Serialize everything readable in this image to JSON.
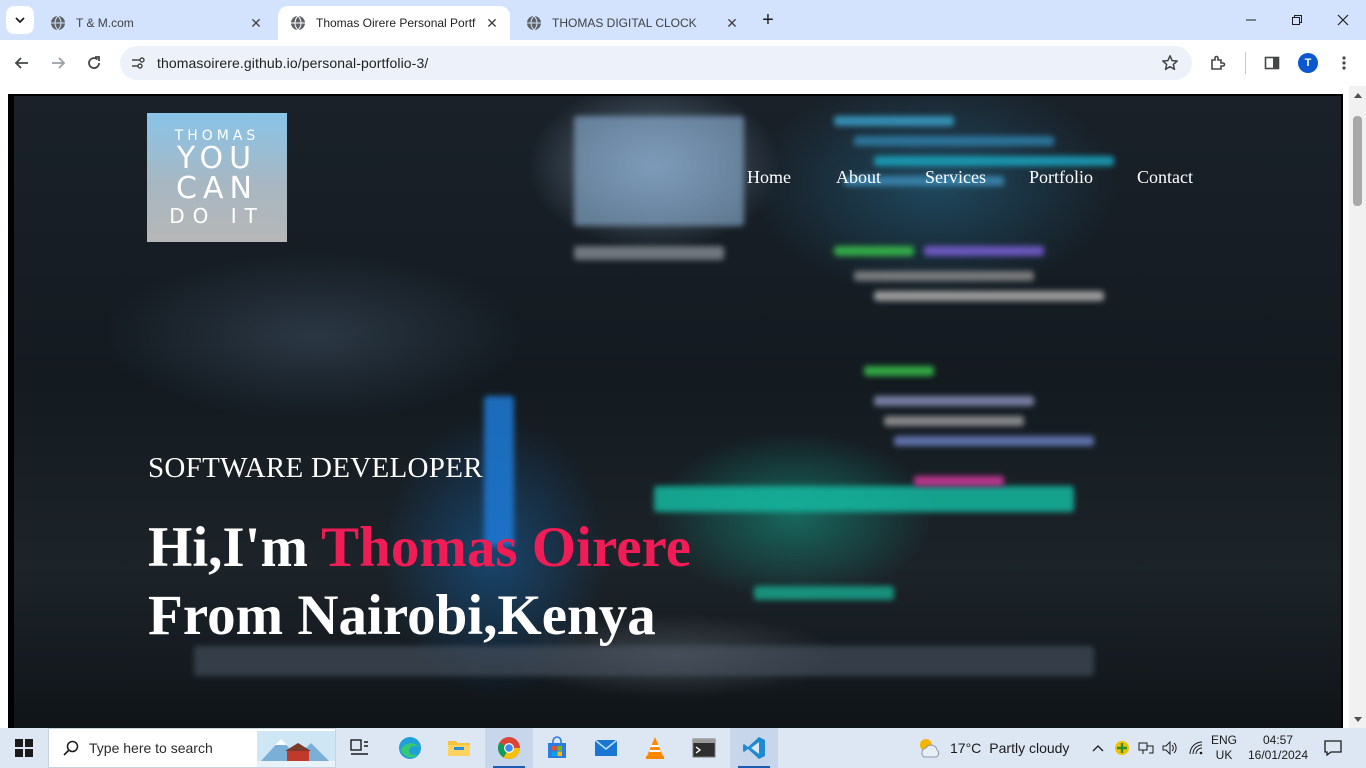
{
  "browser": {
    "tabs": [
      {
        "title": "T & M.com",
        "active": false
      },
      {
        "title": "Thomas Oirere Personal Portfolio",
        "active": true
      },
      {
        "title": "THOMAS DIGITAL CLOCK",
        "active": false
      }
    ],
    "url": "thomasoirere.github.io/personal-portfolio-3/",
    "profile_initial": "T"
  },
  "page": {
    "logo": {
      "line1": "THOMAS",
      "line2": "YOU",
      "line3": "CAN",
      "line4": "DO IT"
    },
    "nav": [
      "Home",
      "About",
      "Services",
      "Portfolio",
      "Contact"
    ],
    "subtitle": "SOFTWARE DEVELOPER",
    "headline": {
      "greeting": "Hi,I'm ",
      "name": "Thomas Oirere",
      "line2": "From Nairobi,Kenya"
    },
    "accent_color": "#ef1c55"
  },
  "taskbar": {
    "search_placeholder": "Type here to search",
    "weather": {
      "temp": "17°C",
      "condition": "Partly cloudy"
    },
    "language": {
      "line1": "ENG",
      "line2": "UK"
    },
    "clock": {
      "time": "04:57",
      "date": "16/01/2024"
    },
    "apps": [
      "task-view",
      "edge",
      "file-explorer",
      "chrome",
      "microsoft-store",
      "mail",
      "vlc",
      "terminal",
      "vscode"
    ]
  }
}
